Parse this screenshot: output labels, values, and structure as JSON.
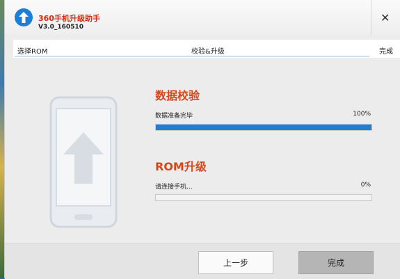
{
  "app": {
    "title": "360手机升级助手",
    "version": "V3.0_160510"
  },
  "titlebar": {
    "close_label": "✕"
  },
  "steps": [
    {
      "label": "选择ROM"
    },
    {
      "label": "校验&升级"
    },
    {
      "label": "完成"
    }
  ],
  "verify": {
    "title": "数据校验",
    "status": "数据准备完毕",
    "percent_label": "100%",
    "progress": 1.0
  },
  "upgrade": {
    "title": "ROM升级",
    "status": "请连接手机...",
    "percent_label": "0%",
    "progress": 0.0
  },
  "footer": {
    "prev_label": "上一步",
    "done_label": "完成"
  },
  "colors": {
    "accent": "#1b7fd8",
    "title_red": "#d9461c"
  },
  "icons": {
    "logo": "upload-arrow-icon",
    "phone": "phone-upload-icon"
  }
}
